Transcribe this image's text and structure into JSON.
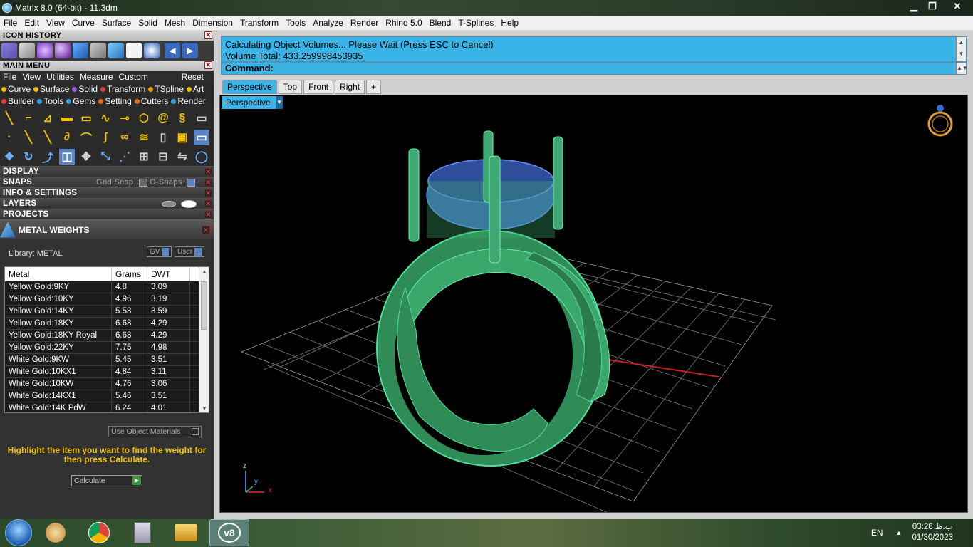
{
  "window": {
    "title": "Matrix 8.0 (64-bit) - 11.3dm",
    "controls": [
      "▁",
      "❐",
      "✕"
    ]
  },
  "menubar": [
    "File",
    "Edit",
    "View",
    "Curve",
    "Surface",
    "Solid",
    "Mesh",
    "Dimension",
    "Transform",
    "Tools",
    "Analyze",
    "Render",
    "Rhino 5.0",
    "Blend",
    "T-Splines",
    "Help"
  ],
  "left_panel": {
    "icon_history_title": "ICON HISTORY",
    "main_menu_title": "MAIN MENU",
    "main_menu_items": [
      "File",
      "View",
      "Utilities",
      "Measure",
      "Custom"
    ],
    "main_menu_reset": "Reset",
    "tab_row_1": [
      {
        "label": "Curve",
        "color": "#f0c000"
      },
      {
        "label": "Surface",
        "color": "#f0c000"
      },
      {
        "label": "Solid",
        "color": "#a060e0"
      },
      {
        "label": "Transform",
        "color": "#e04040"
      },
      {
        "label": "TSpline",
        "color": "#f0a000"
      },
      {
        "label": "Art",
        "color": "#f0c000"
      }
    ],
    "tab_row_2": [
      {
        "label": "Builder",
        "color": "#e04040"
      },
      {
        "label": "Tools",
        "color": "#3aa0e0"
      },
      {
        "label": "Gems",
        "color": "#3aa0e0"
      },
      {
        "label": "Setting",
        "color": "#e07020"
      },
      {
        "label": "Cutters",
        "color": "#e07020"
      },
      {
        "label": "Render",
        "color": "#3aa0e0"
      }
    ],
    "sections": {
      "display": "DISPLAY",
      "snaps": "SNAPS",
      "grid_snap": "Grid Snap",
      "o_snaps": "O-Snaps",
      "info": "INFO & SETTINGS",
      "layers": "LAYERS",
      "projects": "PROJECTS"
    },
    "metal_weights": {
      "title": "METAL WEIGHTS",
      "library": "Library: METAL",
      "gv_label": "GV",
      "user_label": "User",
      "columns": [
        "Metal",
        "Grams",
        "DWT"
      ],
      "rows": [
        [
          "Yellow Gold:9KY",
          "4.8",
          "3.09"
        ],
        [
          "Yellow Gold:10KY",
          "4.96",
          "3.19"
        ],
        [
          "Yellow Gold:14KY",
          "5.58",
          "3.59"
        ],
        [
          "Yellow Gold:18KY",
          "6.68",
          "4.29"
        ],
        [
          "Yellow Gold:18KY Royal",
          "6.68",
          "4.29"
        ],
        [
          "Yellow Gold:22KY",
          "7.75",
          "4.98"
        ],
        [
          "White Gold:9KW",
          "5.45",
          "3.51"
        ],
        [
          "White Gold:10KX1",
          "4.84",
          "3.11"
        ],
        [
          "White Gold:10KW",
          "4.76",
          "3.06"
        ],
        [
          "White Gold:14KX1",
          "5.46",
          "3.51"
        ],
        [
          "White Gold:14K PdW",
          "6.24",
          "4.01"
        ]
      ],
      "use_object_materials": "Use Object Materials",
      "hint": "Highlight the item you want to find the weight for then press Calculate.",
      "calculate": "Calculate"
    }
  },
  "command": {
    "line1": "Calculating Object Volumes... Please Wait (Press ESC to Cancel)",
    "line2": "Volume Total: 433.259998453935",
    "prompt": "Command:"
  },
  "viewport_tabs": [
    "Perspective",
    "Top",
    "Front",
    "Right"
  ],
  "viewport_add_tab": "+",
  "viewport_label": "Perspective",
  "axis": {
    "z": "z",
    "y": "y",
    "x": "x"
  },
  "taskbar": {
    "language": "EN",
    "time": "03:26 ب.ظ",
    "date": "01/30/2023",
    "active_app_label": "v8"
  }
}
